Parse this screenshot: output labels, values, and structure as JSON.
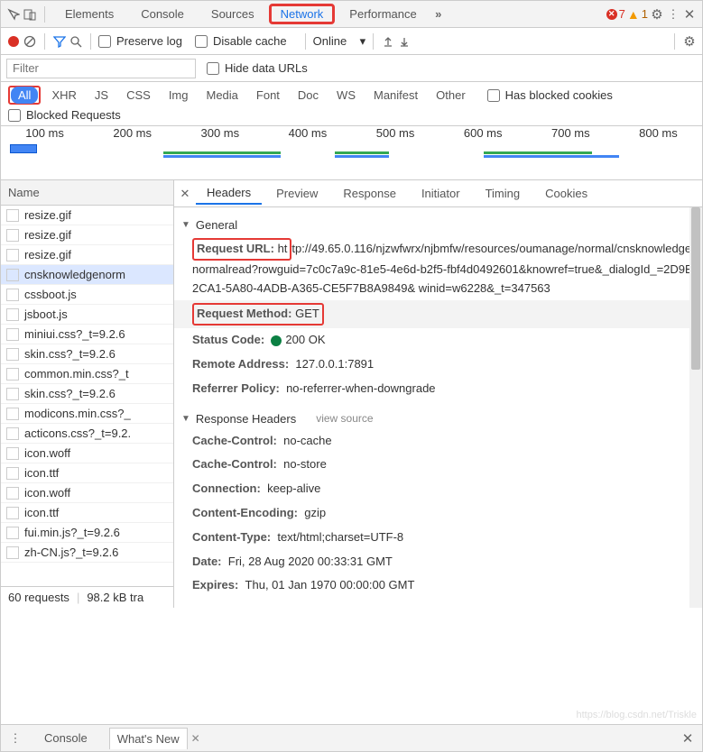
{
  "mainTabs": {
    "elements": "Elements",
    "console": "Console",
    "sources": "Sources",
    "network": "Network",
    "performance": "Performance"
  },
  "errCount": "7",
  "warnCount": "1",
  "opts": {
    "preserve": "Preserve log",
    "disable": "Disable cache",
    "throttle": "Online"
  },
  "filter": {
    "placeholder": "Filter",
    "hide": "Hide data URLs",
    "blocked": "Has blocked cookies",
    "blockedReq": "Blocked Requests"
  },
  "types": {
    "all": "All",
    "xhr": "XHR",
    "js": "JS",
    "css": "CSS",
    "img": "Img",
    "media": "Media",
    "font": "Font",
    "doc": "Doc",
    "ws": "WS",
    "manifest": "Manifest",
    "other": "Other"
  },
  "ticks": [
    "100 ms",
    "200 ms",
    "300 ms",
    "400 ms",
    "500 ms",
    "600 ms",
    "700 ms",
    "800 ms"
  ],
  "nameHdr": "Name",
  "reqs": [
    {
      "n": "resize.gif",
      "sel": false
    },
    {
      "n": "resize.gif",
      "sel": false
    },
    {
      "n": "resize.gif",
      "sel": false
    },
    {
      "n": "cnsknowledgenorm",
      "sel": true
    },
    {
      "n": "cssboot.js",
      "sel": false
    },
    {
      "n": "jsboot.js",
      "sel": false
    },
    {
      "n": "miniui.css?_t=9.2.6",
      "sel": false
    },
    {
      "n": "skin.css?_t=9.2.6",
      "sel": false
    },
    {
      "n": "common.min.css?_t",
      "sel": false
    },
    {
      "n": "skin.css?_t=9.2.6",
      "sel": false
    },
    {
      "n": "modicons.min.css?_",
      "sel": false
    },
    {
      "n": "acticons.css?_t=9.2.",
      "sel": false
    },
    {
      "n": "icon.woff",
      "sel": false
    },
    {
      "n": "icon.ttf",
      "sel": false
    },
    {
      "n": "icon.woff",
      "sel": false
    },
    {
      "n": "icon.ttf",
      "sel": false
    },
    {
      "n": "fui.min.js?_t=9.2.6",
      "sel": false
    },
    {
      "n": "zh-CN.js?_t=9.2.6",
      "sel": false
    }
  ],
  "status": {
    "reqs": "60 requests",
    "xfer": "98.2 kB tra"
  },
  "subTabs": {
    "headers": "Headers",
    "preview": "Preview",
    "response": "Response",
    "initiator": "Initiator",
    "timing": "Timing",
    "cookies": "Cookies"
  },
  "general": {
    "title": "General",
    "urlK": "Request URL:",
    "urlV1": "ht",
    "urlV2": "tp://49.65.0.116/njzwfwrx/njbmfw/resources/oumanage/normal/cnsknowledgenormalread?rowguid=7c0c7a9c-81e5-4e6d-b2f5-fbf4d0492601&knowref=true&_dialogId_=2D9E2CA1-5A80-4ADB-A365-CE5F7B8A9849& winid=w6228&_t=347563",
    "methodK": "Request Method:",
    "methodV": "GET",
    "statusK": "Status Code:",
    "statusV": "200 OK",
    "remoteK": "Remote Address:",
    "remoteV": "127.0.0.1:7891",
    "refK": "Referrer Policy:",
    "refV": "no-referrer-when-downgrade"
  },
  "respHdr": {
    "title": "Response Headers",
    "vs": "view source",
    "items": [
      {
        "k": "Cache-Control:",
        "v": "no-cache"
      },
      {
        "k": "Cache-Control:",
        "v": "no-store"
      },
      {
        "k": "Connection:",
        "v": "keep-alive"
      },
      {
        "k": "Content-Encoding:",
        "v": "gzip"
      },
      {
        "k": "Content-Type:",
        "v": "text/html;charset=UTF-8"
      },
      {
        "k": "Date:",
        "v": "Fri, 28 Aug 2020 00:33:31 GMT"
      },
      {
        "k": "Expires:",
        "v": "Thu, 01 Jan 1970 00:00:00 GMT"
      }
    ]
  },
  "drawer": {
    "console": "Console",
    "whatsnew": "What's New"
  },
  "watermark": "https://blog.csdn.net/Triskle"
}
